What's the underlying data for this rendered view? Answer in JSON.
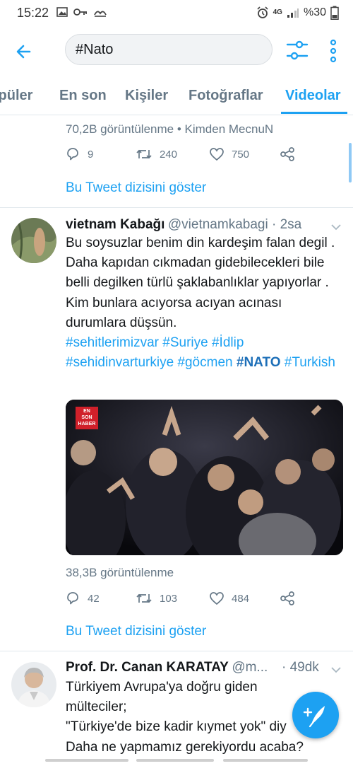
{
  "status_bar": {
    "time": "15:22",
    "network": "4G",
    "battery": "%30",
    "icons": [
      "image-icon",
      "key-icon",
      "hands-icon",
      "alarm-icon",
      "signal-icon",
      "battery-icon"
    ]
  },
  "search": {
    "query": "#Nato",
    "back_icon": "arrow-left-icon",
    "filter_icon": "sliders-icon",
    "more_icon": "vertical-dots-icon"
  },
  "tabs": [
    {
      "label": "Popüler",
      "active": false
    },
    {
      "label": "En son",
      "active": false
    },
    {
      "label": "Kişiler",
      "active": false
    },
    {
      "label": "Fotoğraflar",
      "active": false
    },
    {
      "label": "Videolar",
      "active": true
    }
  ],
  "prev_tweet": {
    "views": "70,2B görüntülenme • Kimden MecnuN",
    "replies": "9",
    "retweets": "240",
    "likes": "750",
    "show_thread": "Bu Tweet dizisini göster"
  },
  "tweet1": {
    "name": "vietnam Kabağı",
    "handle": "@vietnamkabagi · 2sa",
    "text": "Bu soysuzlar benim din kardeşim falan degil . Daha kapıdan cıkmadan gidebilecekleri bile belli degilken türlü şaklabanlıklar yapıyorlar . Kim bunlara acıyorsa acıyan acınası durumlara düşsün.",
    "tags": [
      "#sehitlerimizvar",
      "#Suriye",
      "#İdlip",
      "#sehidinvarturkiye",
      "#göcmen",
      "#NATO",
      "#Turkish"
    ],
    "video_logo": [
      "EN",
      "SON",
      "HABER"
    ],
    "views": "38,3B görüntülenme",
    "replies": "42",
    "retweets": "103",
    "likes": "484",
    "show_thread": "Bu Tweet dizisini göster"
  },
  "tweet2": {
    "name": "Prof. Dr. Canan KARATAY",
    "handle": "@m...",
    "time": "· 49dk",
    "line1": "Türkiyem Avrupa'ya doğru giden",
    "line2": "mülteciler;",
    "line3": "\"Türkiye'de bize kadir kıymet yok\" diy",
    "line4": "Daha ne yapmamız gerekiyordu acaba?"
  },
  "fab_icon": "compose-feather-icon",
  "colors": {
    "accent": "#1da1f2",
    "text": "#14171a",
    "secondary": "#657786",
    "divider": "#e1e8ed"
  }
}
